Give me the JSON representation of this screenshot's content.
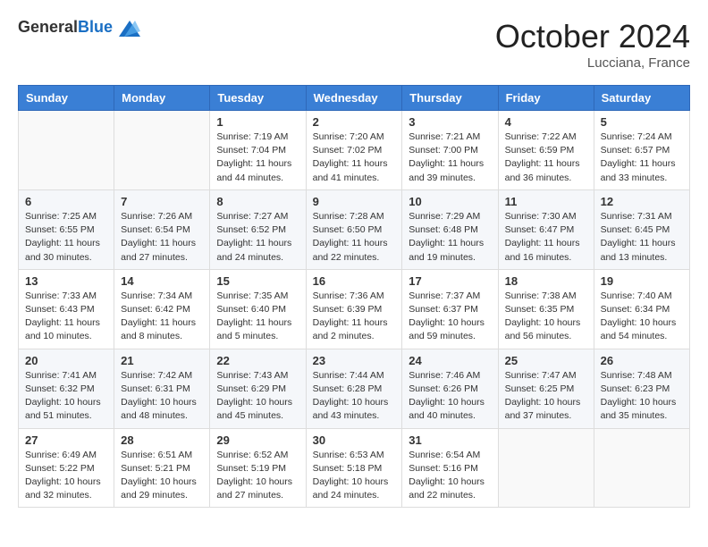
{
  "header": {
    "logo_general": "General",
    "logo_blue": "Blue",
    "month": "October 2024",
    "location": "Lucciana, France"
  },
  "days_of_week": [
    "Sunday",
    "Monday",
    "Tuesday",
    "Wednesday",
    "Thursday",
    "Friday",
    "Saturday"
  ],
  "weeks": [
    [
      {
        "day": "",
        "info": ""
      },
      {
        "day": "",
        "info": ""
      },
      {
        "day": "1",
        "info": "Sunrise: 7:19 AM\nSunset: 7:04 PM\nDaylight: 11 hours and 44 minutes."
      },
      {
        "day": "2",
        "info": "Sunrise: 7:20 AM\nSunset: 7:02 PM\nDaylight: 11 hours and 41 minutes."
      },
      {
        "day": "3",
        "info": "Sunrise: 7:21 AM\nSunset: 7:00 PM\nDaylight: 11 hours and 39 minutes."
      },
      {
        "day": "4",
        "info": "Sunrise: 7:22 AM\nSunset: 6:59 PM\nDaylight: 11 hours and 36 minutes."
      },
      {
        "day": "5",
        "info": "Sunrise: 7:24 AM\nSunset: 6:57 PM\nDaylight: 11 hours and 33 minutes."
      }
    ],
    [
      {
        "day": "6",
        "info": "Sunrise: 7:25 AM\nSunset: 6:55 PM\nDaylight: 11 hours and 30 minutes."
      },
      {
        "day": "7",
        "info": "Sunrise: 7:26 AM\nSunset: 6:54 PM\nDaylight: 11 hours and 27 minutes."
      },
      {
        "day": "8",
        "info": "Sunrise: 7:27 AM\nSunset: 6:52 PM\nDaylight: 11 hours and 24 minutes."
      },
      {
        "day": "9",
        "info": "Sunrise: 7:28 AM\nSunset: 6:50 PM\nDaylight: 11 hours and 22 minutes."
      },
      {
        "day": "10",
        "info": "Sunrise: 7:29 AM\nSunset: 6:48 PM\nDaylight: 11 hours and 19 minutes."
      },
      {
        "day": "11",
        "info": "Sunrise: 7:30 AM\nSunset: 6:47 PM\nDaylight: 11 hours and 16 minutes."
      },
      {
        "day": "12",
        "info": "Sunrise: 7:31 AM\nSunset: 6:45 PM\nDaylight: 11 hours and 13 minutes."
      }
    ],
    [
      {
        "day": "13",
        "info": "Sunrise: 7:33 AM\nSunset: 6:43 PM\nDaylight: 11 hours and 10 minutes."
      },
      {
        "day": "14",
        "info": "Sunrise: 7:34 AM\nSunset: 6:42 PM\nDaylight: 11 hours and 8 minutes."
      },
      {
        "day": "15",
        "info": "Sunrise: 7:35 AM\nSunset: 6:40 PM\nDaylight: 11 hours and 5 minutes."
      },
      {
        "day": "16",
        "info": "Sunrise: 7:36 AM\nSunset: 6:39 PM\nDaylight: 11 hours and 2 minutes."
      },
      {
        "day": "17",
        "info": "Sunrise: 7:37 AM\nSunset: 6:37 PM\nDaylight: 10 hours and 59 minutes."
      },
      {
        "day": "18",
        "info": "Sunrise: 7:38 AM\nSunset: 6:35 PM\nDaylight: 10 hours and 56 minutes."
      },
      {
        "day": "19",
        "info": "Sunrise: 7:40 AM\nSunset: 6:34 PM\nDaylight: 10 hours and 54 minutes."
      }
    ],
    [
      {
        "day": "20",
        "info": "Sunrise: 7:41 AM\nSunset: 6:32 PM\nDaylight: 10 hours and 51 minutes."
      },
      {
        "day": "21",
        "info": "Sunrise: 7:42 AM\nSunset: 6:31 PM\nDaylight: 10 hours and 48 minutes."
      },
      {
        "day": "22",
        "info": "Sunrise: 7:43 AM\nSunset: 6:29 PM\nDaylight: 10 hours and 45 minutes."
      },
      {
        "day": "23",
        "info": "Sunrise: 7:44 AM\nSunset: 6:28 PM\nDaylight: 10 hours and 43 minutes."
      },
      {
        "day": "24",
        "info": "Sunrise: 7:46 AM\nSunset: 6:26 PM\nDaylight: 10 hours and 40 minutes."
      },
      {
        "day": "25",
        "info": "Sunrise: 7:47 AM\nSunset: 6:25 PM\nDaylight: 10 hours and 37 minutes."
      },
      {
        "day": "26",
        "info": "Sunrise: 7:48 AM\nSunset: 6:23 PM\nDaylight: 10 hours and 35 minutes."
      }
    ],
    [
      {
        "day": "27",
        "info": "Sunrise: 6:49 AM\nSunset: 5:22 PM\nDaylight: 10 hours and 32 minutes."
      },
      {
        "day": "28",
        "info": "Sunrise: 6:51 AM\nSunset: 5:21 PM\nDaylight: 10 hours and 29 minutes."
      },
      {
        "day": "29",
        "info": "Sunrise: 6:52 AM\nSunset: 5:19 PM\nDaylight: 10 hours and 27 minutes."
      },
      {
        "day": "30",
        "info": "Sunrise: 6:53 AM\nSunset: 5:18 PM\nDaylight: 10 hours and 24 minutes."
      },
      {
        "day": "31",
        "info": "Sunrise: 6:54 AM\nSunset: 5:16 PM\nDaylight: 10 hours and 22 minutes."
      },
      {
        "day": "",
        "info": ""
      },
      {
        "day": "",
        "info": ""
      }
    ]
  ]
}
